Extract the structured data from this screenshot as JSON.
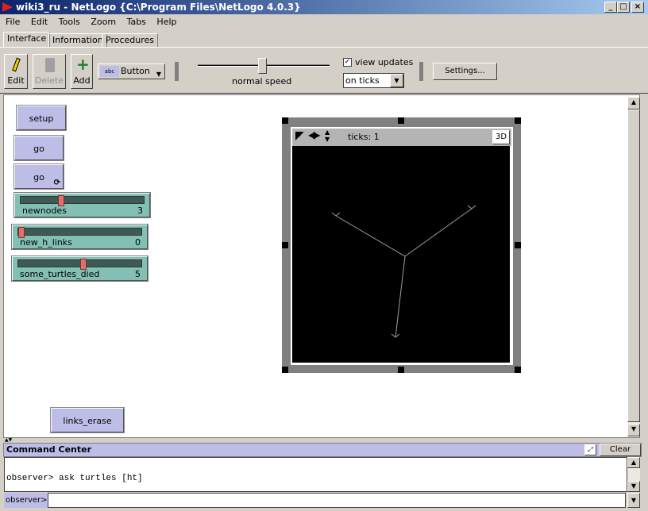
{
  "window": {
    "title": "wiki3_ru - NetLogo {C:\\Program Files\\NetLogo 4.0.3}"
  },
  "menu": [
    "File",
    "Edit",
    "Tools",
    "Zoom",
    "Tabs",
    "Help"
  ],
  "tabs": [
    "Interface",
    "Information",
    "Procedures"
  ],
  "toolbar": {
    "edit": "Edit",
    "delete": "Delete",
    "add": "Add",
    "widget_type": "Button",
    "speed_label": "normal speed",
    "speed_value": 0.5,
    "view_updates": "view updates",
    "view_updates_checked": true,
    "update_mode": "on ticks",
    "settings": "Settings..."
  },
  "widgets": {
    "setup": "setup",
    "go": "go",
    "go_forever": "go",
    "links_erase": "links_erase",
    "sliders": [
      {
        "label": "newnodes",
        "value": "3",
        "fraction": 0.3
      },
      {
        "label": "new_h_links",
        "value": "0",
        "fraction": 0
      },
      {
        "label": "some_turtles_died",
        "value": "5",
        "fraction": 0.5
      }
    ]
  },
  "view": {
    "ticks": "ticks: 1",
    "three_d": "3D",
    "background": "#000000",
    "link_color": "#a0a0a0"
  },
  "command_center": {
    "title": "Command Center",
    "clear": "Clear",
    "output": "observer> ask turtles [ht]",
    "prompt": "observer>",
    "input": ""
  }
}
